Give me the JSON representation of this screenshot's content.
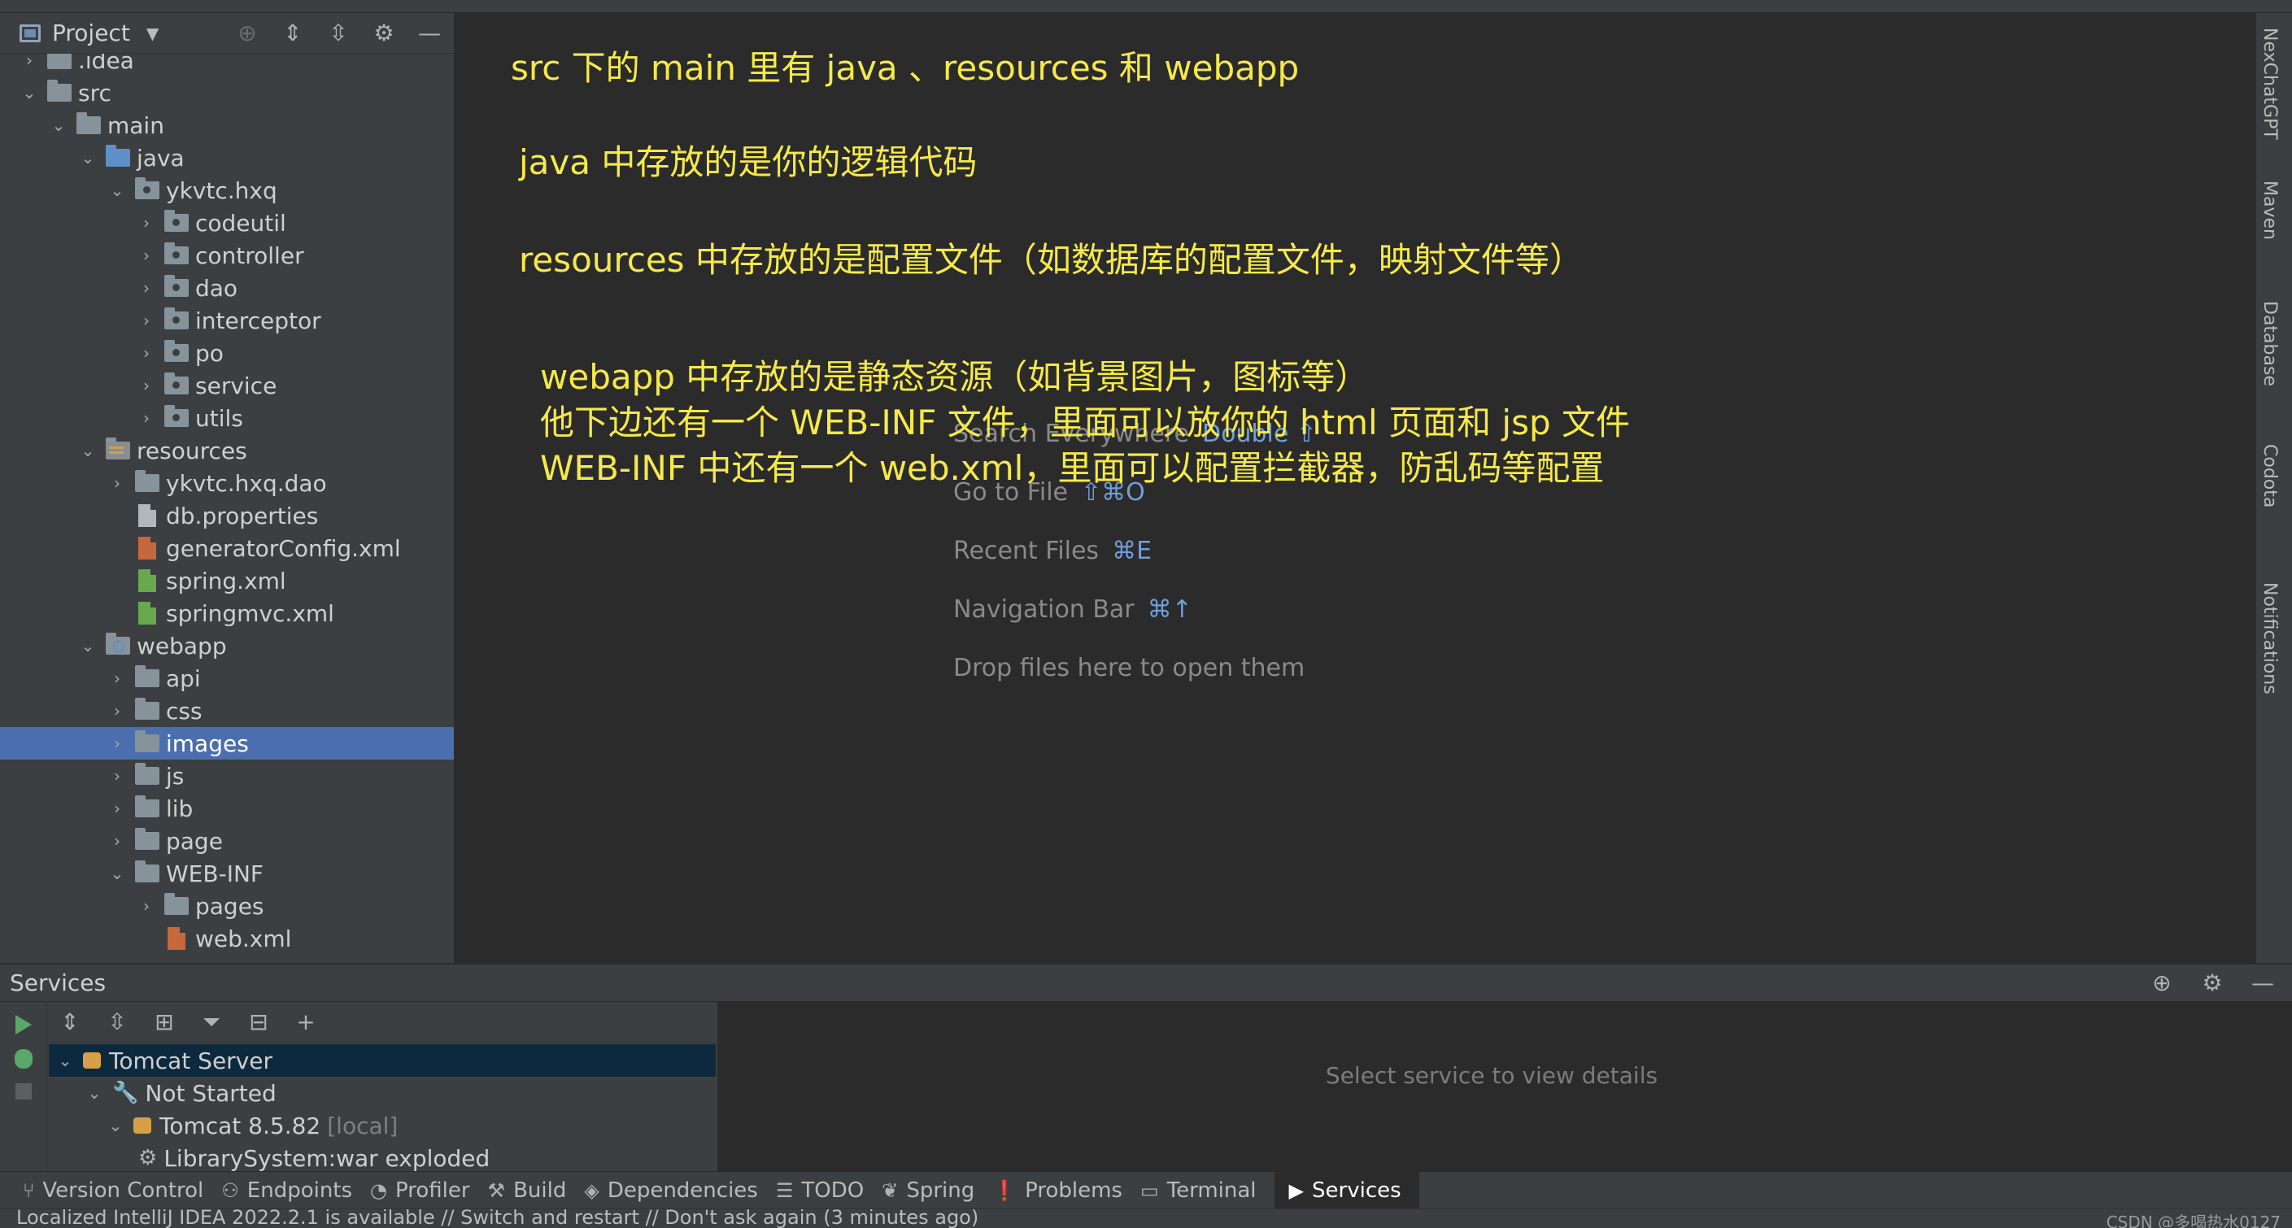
{
  "project_panel": {
    "title": "Project",
    "tree": [
      {
        "label": ".idea",
        "depth": 1,
        "arrow": "collapsed",
        "icon": "folder"
      },
      {
        "label": "src",
        "depth": 1,
        "arrow": "expanded",
        "icon": "folder"
      },
      {
        "label": "main",
        "depth": 2,
        "arrow": "expanded",
        "icon": "folder"
      },
      {
        "label": "java",
        "depth": 3,
        "arrow": "expanded",
        "icon": "folder-blue"
      },
      {
        "label": "ykvtc.hxq",
        "depth": 4,
        "arrow": "expanded",
        "icon": "package"
      },
      {
        "label": "codeutil",
        "depth": 5,
        "arrow": "collapsed",
        "icon": "package"
      },
      {
        "label": "controller",
        "depth": 5,
        "arrow": "collapsed",
        "icon": "package"
      },
      {
        "label": "dao",
        "depth": 5,
        "arrow": "collapsed",
        "icon": "package"
      },
      {
        "label": "interceptor",
        "depth": 5,
        "arrow": "collapsed",
        "icon": "package"
      },
      {
        "label": "po",
        "depth": 5,
        "arrow": "collapsed",
        "icon": "package"
      },
      {
        "label": "service",
        "depth": 5,
        "arrow": "collapsed",
        "icon": "package"
      },
      {
        "label": "utils",
        "depth": 5,
        "arrow": "collapsed",
        "icon": "package"
      },
      {
        "label": "resources",
        "depth": 3,
        "arrow": "expanded",
        "icon": "folder-resources"
      },
      {
        "label": "ykvtc.hxq.dao",
        "depth": 4,
        "arrow": "collapsed",
        "icon": "folder"
      },
      {
        "label": "db.properties",
        "depth": 4,
        "arrow": "none",
        "icon": "file-properties"
      },
      {
        "label": "generatorConfig.xml",
        "depth": 4,
        "arrow": "none",
        "icon": "file-xml"
      },
      {
        "label": "spring.xml",
        "depth": 4,
        "arrow": "none",
        "icon": "file-spring"
      },
      {
        "label": "springmvc.xml",
        "depth": 4,
        "arrow": "none",
        "icon": "file-spring"
      },
      {
        "label": "webapp",
        "depth": 3,
        "arrow": "expanded",
        "icon": "folder-web"
      },
      {
        "label": "api",
        "depth": 4,
        "arrow": "collapsed",
        "icon": "folder"
      },
      {
        "label": "css",
        "depth": 4,
        "arrow": "collapsed",
        "icon": "folder"
      },
      {
        "label": "images",
        "depth": 4,
        "arrow": "collapsed",
        "icon": "folder",
        "selected": true
      },
      {
        "label": "js",
        "depth": 4,
        "arrow": "collapsed",
        "icon": "folder"
      },
      {
        "label": "lib",
        "depth": 4,
        "arrow": "collapsed",
        "icon": "folder"
      },
      {
        "label": "page",
        "depth": 4,
        "arrow": "collapsed",
        "icon": "folder"
      },
      {
        "label": "WEB-INF",
        "depth": 4,
        "arrow": "expanded",
        "icon": "folder"
      },
      {
        "label": "pages",
        "depth": 5,
        "arrow": "collapsed",
        "icon": "folder"
      },
      {
        "label": "web.xml",
        "depth": 5,
        "arrow": "none",
        "icon": "file-xml"
      }
    ]
  },
  "editor": {
    "annotations": [
      "src 下的 main 里有 java 、resources 和 webapp",
      "java 中存放的是你的逻辑代码",
      "resources 中存放的是配置文件（如数据库的配置文件，映射文件等）",
      "webapp 中存放的是静态资源（如背景图片，图标等）",
      "他下边还有一个 WEB-INF 文件，里面可以放你的 html 页面和 jsp 文件",
      "WEB-INF 中还有一个 web.xml，里面可以配置拦截器，防乱码等配置"
    ],
    "hints": [
      {
        "label": "Search Everywhere",
        "key": "Double ⇧"
      },
      {
        "label": "Go to File",
        "key": "⇧⌘O"
      },
      {
        "label": "Recent Files",
        "key": "⌘E"
      },
      {
        "label": "Navigation Bar",
        "key": "⌘↑"
      },
      {
        "label": "Drop files here to open them",
        "key": ""
      }
    ]
  },
  "right_strip": {
    "tabs": [
      "NexChatGPT",
      "Maven",
      "Database",
      "Codota",
      "Notifications"
    ]
  },
  "services": {
    "title": "Services",
    "tree": [
      {
        "label": "Tomcat Server",
        "suffix": "",
        "selected": true
      },
      {
        "label": "Not Started",
        "suffix": ""
      },
      {
        "label": "Tomcat 8.5.82",
        "suffix": "[local]"
      },
      {
        "label": "LibrarySystem:war exploded",
        "suffix": ""
      }
    ],
    "detail_message": "Select service to view details"
  },
  "bottom_tabs": [
    {
      "label": "Version Control",
      "icon": "version-control-icon",
      "glyph": "⑂"
    },
    {
      "label": "Endpoints",
      "icon": "endpoints-icon",
      "glyph": "⚇"
    },
    {
      "label": "Profiler",
      "icon": "profiler-icon",
      "glyph": "◔"
    },
    {
      "label": "Build",
      "icon": "build-icon",
      "glyph": "⚒"
    },
    {
      "label": "Dependencies",
      "icon": "dependencies-icon",
      "glyph": "◈"
    },
    {
      "label": "TODO",
      "icon": "todo-icon",
      "glyph": "☰"
    },
    {
      "label": "Spring",
      "icon": "spring-icon",
      "glyph": "❦"
    },
    {
      "label": "Problems",
      "icon": "problems-icon",
      "glyph": "❗"
    },
    {
      "label": "Terminal",
      "icon": "terminal-icon",
      "glyph": "▭"
    },
    {
      "label": "Services",
      "icon": "services-icon",
      "glyph": "▶",
      "active": true
    }
  ],
  "status_bar": {
    "message": "Localized IntelliJ IDEA 2022.2.1 is available // Switch and restart // Don't ask again (3 minutes ago)",
    "watermark": "CSDN @多喝热水0127"
  }
}
